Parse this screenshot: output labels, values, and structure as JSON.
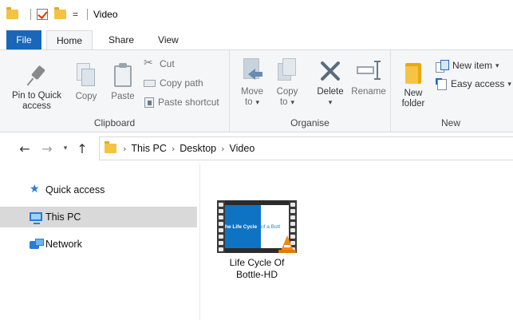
{
  "window": {
    "title": "Video"
  },
  "quick_access_toolbar": {
    "dropdown_glyph": "="
  },
  "ribbon_tabs": [
    {
      "label": "File"
    },
    {
      "label": "Home"
    },
    {
      "label": "Share"
    },
    {
      "label": "View"
    }
  ],
  "ribbon": {
    "clipboard": {
      "label": "Clipboard",
      "pin_to_quick_access": [
        "Pin to Quick",
        "access"
      ],
      "copy": "Copy",
      "paste": "Paste",
      "cut": "Cut",
      "copy_path": "Copy path",
      "paste_shortcut": "Paste shortcut"
    },
    "organise": {
      "label": "Organise",
      "move_to": [
        "Move",
        "to"
      ],
      "copy_to": [
        "Copy",
        "to"
      ],
      "delete": "Delete",
      "rename": "Rename"
    },
    "new": {
      "label": "New",
      "new_folder": [
        "New",
        "folder"
      ],
      "new_item": "New item",
      "easy_access": "Easy access"
    }
  },
  "address_bar": {
    "breadcrumbs": [
      "This PC",
      "Desktop",
      "Video"
    ]
  },
  "navigation_pane": {
    "items": [
      {
        "label": "Quick access",
        "icon": "star-icon",
        "selected": false
      },
      {
        "label": "This PC",
        "icon": "computer-icon",
        "selected": true
      },
      {
        "label": "Network",
        "icon": "network-icon",
        "selected": false
      }
    ]
  },
  "files": [
    {
      "name_lines": [
        "Life Cycle Of",
        "Bottle-HD"
      ],
      "thumbnail_text_left": "he Life Cycle",
      "thumbnail_text_right": "of a Bott",
      "icon": "vlc-video-icon"
    }
  ],
  "colors": {
    "file_tab": "#1a66b8",
    "selection": "#d9d9d9",
    "folder": "#f5c242",
    "accent_blue": "#2a7bd5"
  }
}
